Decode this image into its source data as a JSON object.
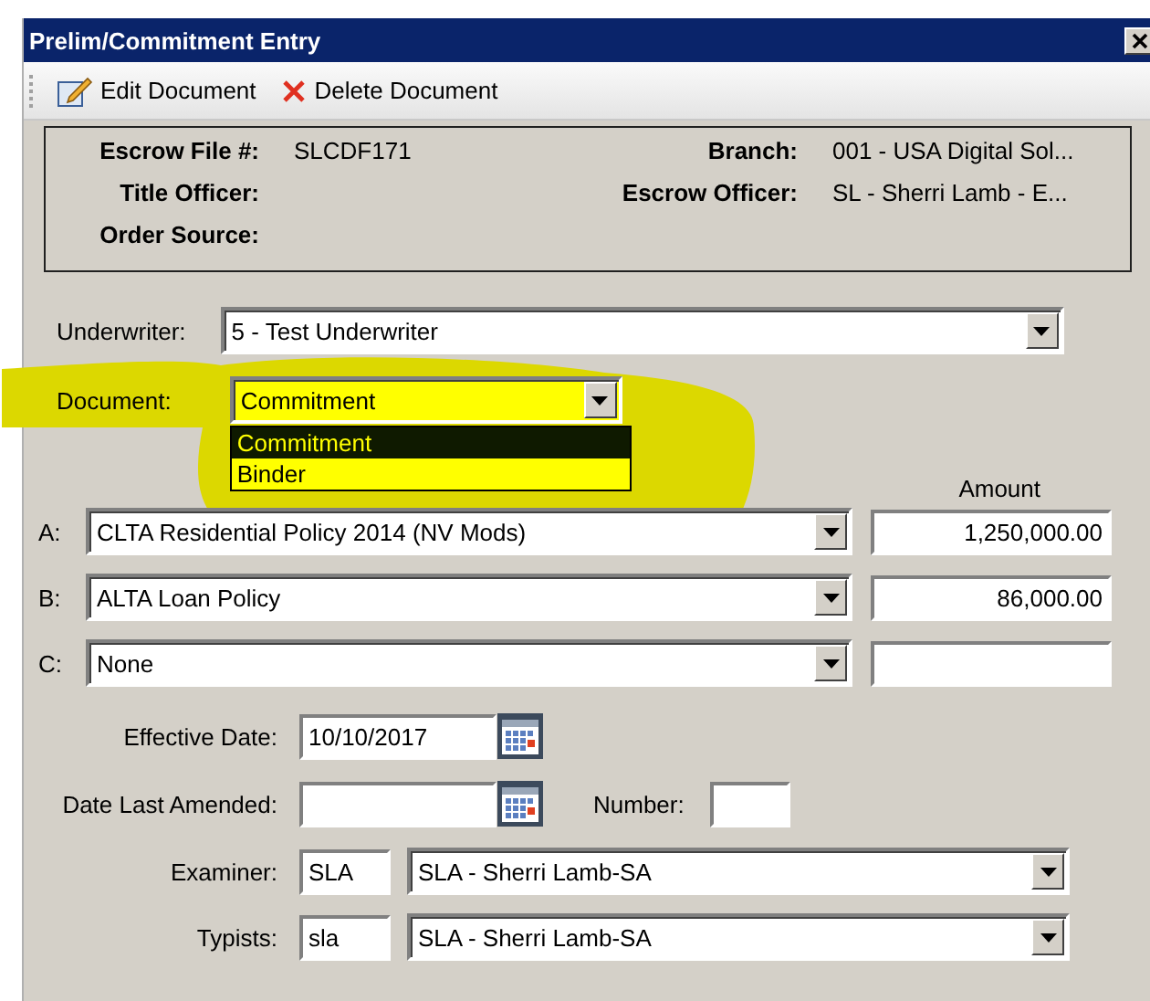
{
  "window": {
    "title": "Prelim/Commitment Entry"
  },
  "toolbar": [
    {
      "label": "Edit Document",
      "kind": "edit"
    },
    {
      "label": "Delete Document",
      "kind": "delete"
    }
  ],
  "file_info": [
    {
      "left_label": "Escrow File #:",
      "left_value": "SLCDF171",
      "right_label": "Branch:",
      "right_value": "001 - USA Digital Sol..."
    },
    {
      "left_label": "Title Officer:",
      "right_label": "Escrow Officer:",
      "right_value": "SL  - Sherri Lamb - E..."
    },
    {
      "left_label": "Order Source:"
    }
  ],
  "underwriter": {
    "label": "Underwriter:",
    "value": "5 - Test Underwriter"
  },
  "document": {
    "label": "Document:",
    "value": "Commitment",
    "expanded": true,
    "options": [
      {
        "label": "Commitment",
        "selected": true
      },
      {
        "label": "Binder",
        "selected": false
      }
    ]
  },
  "policies": {
    "amount_header": "Amount",
    "rows": [
      {
        "letter": "A:",
        "policy": "CLTA Residential Policy 2014 (NV Mods)",
        "amount": "1,250,000.00"
      },
      {
        "letter": "B:",
        "policy": "ALTA Loan Policy",
        "amount": "86,000.00"
      },
      {
        "letter": "C:",
        "policy": "None"
      }
    ]
  },
  "effective_date": {
    "label": "Effective Date:",
    "value": "10/10/2017"
  },
  "date_last_amended": {
    "label": "Date Last Amended:"
  },
  "number": {
    "label": "Number:"
  },
  "examiner": {
    "label": "Examiner:",
    "code": "SLA",
    "value": "SLA - Sherri Lamb-SA"
  },
  "typists": {
    "label": "Typists:",
    "code": "sla",
    "value": "SLA - Sherri Lamb-SA"
  }
}
